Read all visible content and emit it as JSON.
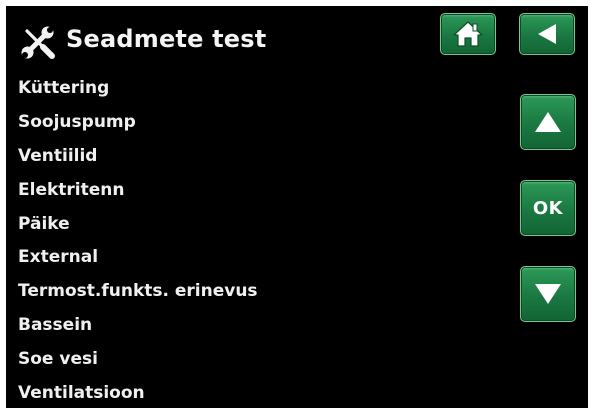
{
  "header": {
    "title": "Seadmete test",
    "title_icon": "tools-icon"
  },
  "menu": {
    "items": [
      {
        "label": "Küttering"
      },
      {
        "label": "Soojuspump"
      },
      {
        "label": "Ventiilid"
      },
      {
        "label": "Elektritenn"
      },
      {
        "label": "Päike"
      },
      {
        "label": "External"
      },
      {
        "label": "Termost.funkts. erinevus"
      },
      {
        "label": "Bassein"
      },
      {
        "label": "Soe vesi"
      },
      {
        "label": "Ventilatsioon"
      }
    ]
  },
  "buttons": {
    "home_icon": "home-icon",
    "back_icon": "back-arrow-icon",
    "up_icon": "up-arrow-icon",
    "ok_label": "OK",
    "down_icon": "down-arrow-icon"
  },
  "colors": {
    "background": "#000000",
    "text": "#f0f0f0",
    "button_green": "#1a7841",
    "button_border": "#7bc595"
  }
}
